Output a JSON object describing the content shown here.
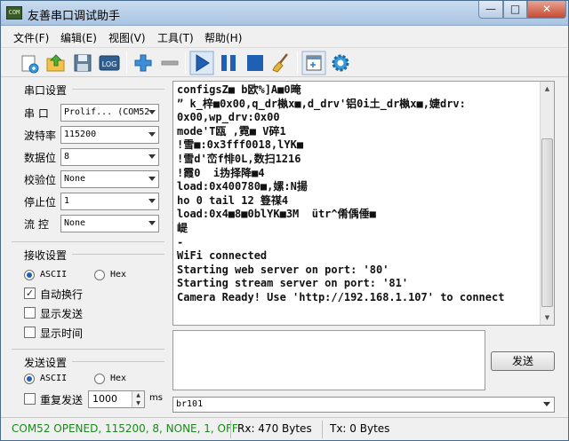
{
  "window": {
    "title": "友善串口调试助手",
    "icon_text": "COM",
    "min_glyph": "—",
    "max_glyph": "□",
    "close_glyph": "✕"
  },
  "menu": [
    "文件(F)",
    "编辑(E)",
    "视图(V)",
    "工具(T)",
    "帮助(H)"
  ],
  "toolbar": {
    "log_label": "LOG",
    "buttons": [
      "new-session-icon",
      "open-folder-icon",
      "save-icon",
      "log-icon",
      "add-icon",
      "remove-icon",
      "play-icon",
      "pause-icon",
      "stop-icon",
      "clear-broom-icon",
      "new-window-icon",
      "settings-gear-icon"
    ]
  },
  "serial": {
    "title": "串口设置",
    "port_label": "串  口",
    "port_value": "Prolif... (COM52",
    "baud_label": "波特率",
    "baud_value": "115200",
    "databits_label": "数据位",
    "databits_value": "8",
    "parity_label": "校验位",
    "parity_value": "None",
    "stopbits_label": "停止位",
    "stopbits_value": "1",
    "flow_label": "流  控",
    "flow_value": "None"
  },
  "receive": {
    "title": "接收设置",
    "ascii_label": "ASCII",
    "hex_label": "Hex",
    "autowrap_label": "自动换行",
    "showsend_label": "显示发送",
    "showtime_label": "显示时间",
    "check_glyph": "✓"
  },
  "send": {
    "title": "发送设置",
    "ascii_label": "ASCII",
    "hex_label": "Hex",
    "repeat_label": "重复发送",
    "interval_value": "1000",
    "interval_unit": "ms",
    "send_button": "发送",
    "command_value": "br101"
  },
  "recv_text": [
    "configsZ■ b欧%]A■0晻",
    "” k_梓■0x00,q_dr槸x■,d_drv'铝0i土_dr槸x■,婕drv:",
    "0x00,wp_drv:0x00",
    "mode'T瓯 ,霓■ V碎1",
    "!雪■:0x3fff0018,lYK■",
    "!雪d'峦f悱0L,数扫1216",
    "!霞0  i㧑择降■4",
    "load:0x400780■,嫘:N揚",
    "ho 0 tail 12 簦禖4",
    "load:0x4■8■0blYK■3M  ütr^倄偊倕■",
    "崼",
    "-",
    "WiFi connected",
    "Starting web server on port: '80'",
    "Starting stream server on port: '81'",
    "Camera Ready! Use 'http://192.168.1.107' to connect"
  ],
  "status": {
    "connection": "COM52 OPENED, 115200, 8, NONE, 1, OFF",
    "rx": "Rx: 470 Bytes",
    "tx": "Tx: 0 Bytes"
  },
  "colors": {
    "status_green": "#1a8a1a",
    "accent_blue": "#1f5fb4"
  }
}
